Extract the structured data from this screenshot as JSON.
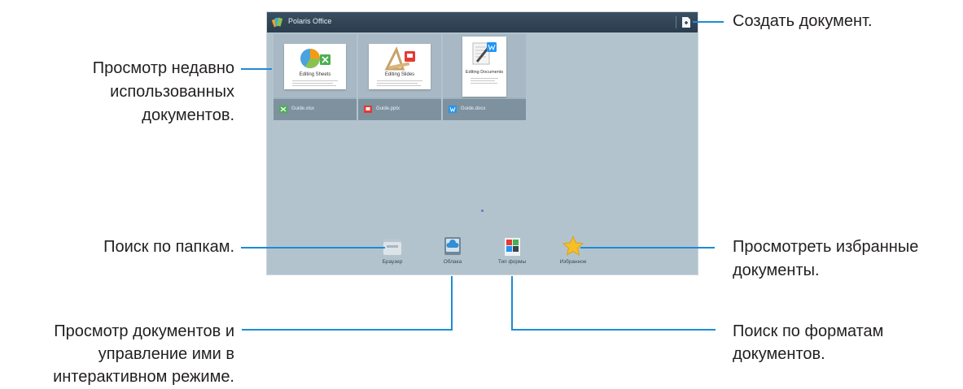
{
  "app": {
    "title": "Polaris Office",
    "icons": {
      "logo": "polaris-logo-icon",
      "new_document": "new-document-icon"
    }
  },
  "recent_documents": [
    {
      "file_name": "Guide.xlsx",
      "thumbnail_caption": "Editing Sheets",
      "type_icon": "excel-icon",
      "accent": "#4caf50"
    },
    {
      "file_name": "Guide.pptx",
      "thumbnail_caption": "Editing Slides",
      "type_icon": "powerpoint-icon",
      "accent": "#e53935"
    },
    {
      "file_name": "Guide.docx",
      "thumbnail_caption": "Editing Documents",
      "type_icon": "word-icon",
      "accent": "#2196f3"
    }
  ],
  "dock": [
    {
      "label": "Браузер",
      "icon": "folder-icon"
    },
    {
      "label": "Облака",
      "icon": "cloud-icon"
    },
    {
      "label": "Тип формы",
      "icon": "document-types-icon"
    },
    {
      "label": "Избранное",
      "icon": "star-icon"
    }
  ],
  "callouts": {
    "create_document": "Создать документ.",
    "recent": [
      "Просмотр недавно",
      "использованных",
      "документов."
    ],
    "browse_folders": "Поиск по папкам.",
    "favorites": [
      "Просмотреть избранные",
      "документы."
    ],
    "cloud": [
      "Просмотр документов и",
      "управление ими в",
      "интерактивном режиме."
    ],
    "formats": [
      "Поиск по форматам",
      "документов."
    ]
  },
  "colors": {
    "callout_line": "#1f8bd3",
    "screen_background": "#b3c3ce",
    "titlebar": "#2f4254"
  }
}
